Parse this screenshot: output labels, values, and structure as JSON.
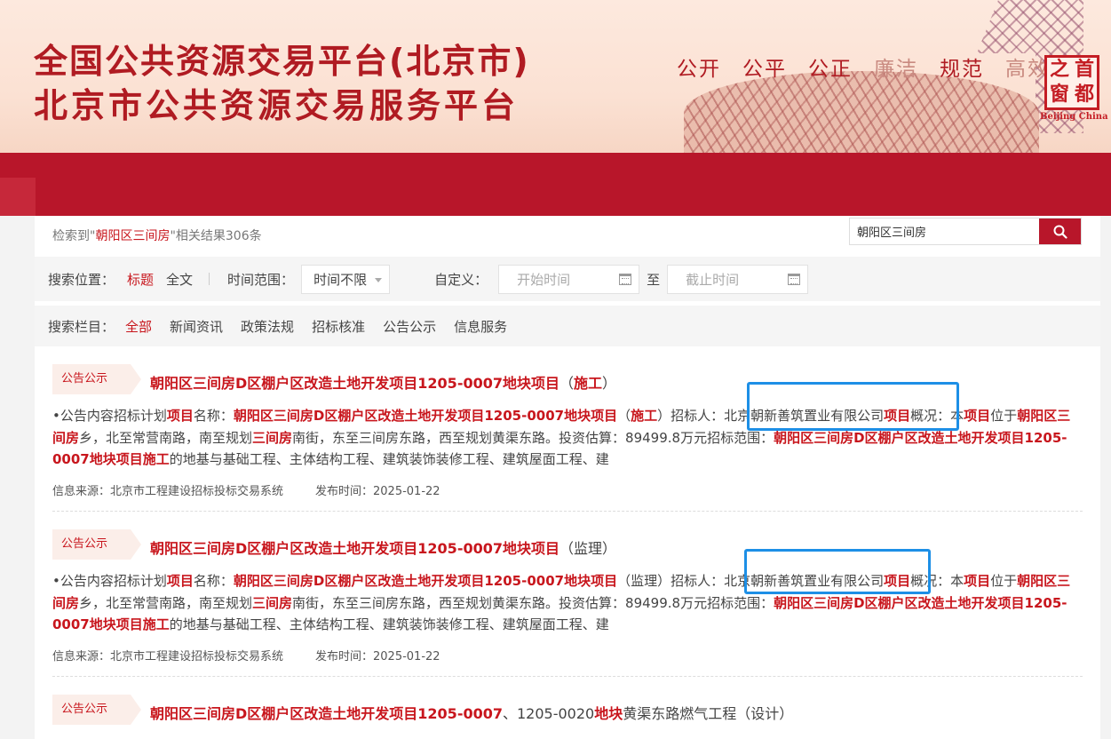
{
  "header": {
    "title_line1": "全国公共资源交易平台(北京市)",
    "title_line2": "北京市公共资源交易服务平台",
    "mottos": [
      "公开",
      "公平",
      "公正",
      "廉洁",
      "规范",
      "高效"
    ],
    "seal_chars": [
      "之",
      "首",
      "窗",
      "都"
    ],
    "seal_caption": "Beijing China",
    "brand_color": "#b01b22"
  },
  "search": {
    "result_prefix": "检索到\"",
    "keyword": "朝阳区三间房",
    "result_suffix": "\"相关结果306条",
    "input_value": "朝阳区三间房",
    "button_icon": "search-icon"
  },
  "filters": {
    "position_label": "搜索位置：",
    "position_options": [
      "标题",
      "全文"
    ],
    "time_label": "时间范围：",
    "time_select": "时间不限",
    "custom_label": "自定义：",
    "start_placeholder": "开始时间",
    "to_label": "至",
    "end_placeholder": "截止时间",
    "column_label": "搜索栏目：",
    "column_options": [
      "全部",
      "新闻资讯",
      "政策法规",
      "招标核准",
      "公告公示",
      "信息服务"
    ]
  },
  "results": [
    {
      "tag": "公告公示",
      "title_main": "朝阳区三间房D区棚户区改造土地开发项目1205-0007地块项目",
      "title_open": "（",
      "title_suffix": "施工",
      "title_close": "）",
      "snippet": {
        "s1": "•公告内容招标计划",
        "k1": "项目",
        "s2": "名称：",
        "k2": "朝阳区三间房D区棚户区改造土地开发项目1205-0007地块项目",
        "s3": "（",
        "k3": "施工",
        "s4": "）招标人：北京朝新善筑置业有限公司",
        "k4": "项目",
        "s5": "概况：本",
        "k5": "项目",
        "s6": "位于",
        "k6": "朝阳区三间房",
        "s7": "乡，北至常营南路，南至规划",
        "k7": "三间房",
        "s8": "南街，东至三间房东路，西至规划黄渠东路。投资估算：89499.8万元招标范围：",
        "k8": "朝阳区三间房D区棚户区改造土地开发项目1205-0007地块项目施工",
        "s9": "的地基与基础工程、主体结构工程、建筑装饰装修工程、建筑屋面工程、建"
      },
      "source": "信息来源：北京市工程建设招标投标交易系统",
      "date": "发布时间：2025-01-22"
    },
    {
      "tag": "公告公示",
      "title_main": "朝阳区三间房D区棚户区改造土地开发项目1205-0007地块项目",
      "title_open": "（",
      "title_suffix": "监理",
      "title_close": "）",
      "snippet": {
        "s1": "•公告内容招标计划",
        "k1": "项目",
        "s2": "名称：",
        "k2": "朝阳区三间房D区棚户区改造土地开发项目1205-0007地块项目",
        "s3": "（监理）招标人：",
        "s4": "北京朝新善筑置业有限公司",
        "k4": "项目",
        "s5": "概况：本",
        "k5": "项目",
        "s6": "位于",
        "k6": "朝阳区三间房",
        "s7": "乡，北至常营南路，南至规划",
        "k7": "三间房",
        "s8": "南街，东至三间房东路，西至规划黄渠东路。投资估算：89499.8万元招标范围：",
        "k8": "朝阳区三间房D区棚户区改造土地开发项目1205-0007地块项目施工",
        "s9": "的地基与基础工程、主体结构工程、建筑装饰装修工程、建筑屋面工程、建"
      },
      "source": "信息来源：北京市工程建设招标投标交易系统",
      "date": "发布时间：2025-01-22"
    },
    {
      "tag": "公告公示",
      "title_a": "朝阳区三间房D区棚户区改造土地开发项目1205-0007",
      "title_b": "、1205-0020",
      "title_c": "地块",
      "title_d": "黄渠东路燃气工程（设计）"
    }
  ],
  "highlight_color": "#1d8fe6"
}
